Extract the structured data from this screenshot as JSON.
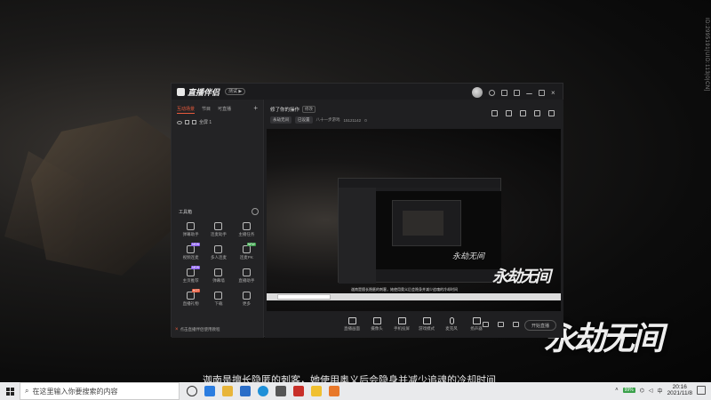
{
  "background": {
    "side_text": "ID:2995191|UID:113|0|CN]",
    "game_logo": "永劫无间",
    "subtitle": "迦南是擅长隐匿的刺客，她使用奥义后会隐身并减少追魂的冷却时间"
  },
  "app": {
    "name": "直播伴侣",
    "version_badge": "测试 ▶",
    "scene_tabs": [
      "互动场景",
      "节目",
      "可直播"
    ],
    "scene_add": "+",
    "scene_item": "全屏 1",
    "toolbox_label": "工具箱",
    "tools": [
      {
        "label": "弹幕助手",
        "icon": "danmaku-icon",
        "tag": ""
      },
      {
        "label": "连麦助手",
        "icon": "mic-assist-icon",
        "tag": ""
      },
      {
        "label": "主播任务",
        "icon": "task-icon",
        "tag": ""
      },
      {
        "label": "视频连麦",
        "icon": "video-link-icon",
        "tag": "NEW"
      },
      {
        "label": "多人连麦",
        "icon": "group-link-icon",
        "tag": ""
      },
      {
        "label": "连麦PK",
        "icon": "pk-icon",
        "tag": "NEW"
      },
      {
        "label": "主页推荐",
        "icon": "home-rec-icon",
        "tag": "NEW"
      },
      {
        "label": "弹幕墙",
        "icon": "barrage-wall-icon",
        "tag": ""
      },
      {
        "label": "直播助手",
        "icon": "live-help-icon",
        "tag": ""
      },
      {
        "label": "直播礼物",
        "icon": "gift-icon",
        "tag": "HOT"
      },
      {
        "label": "下载",
        "icon": "download-icon",
        "tag": ""
      },
      {
        "label": "更多",
        "icon": "more-icon",
        "tag": ""
      }
    ],
    "left_footer": "点击直播伴侣使用教程",
    "main": {
      "title": "修了你的操作",
      "edit": "修改",
      "meta": [
        "永劫无间",
        "已设置",
        "八十一步游戏",
        "15121142",
        "0"
      ]
    },
    "controls": [
      {
        "label": "直播画面",
        "icon": "screen-icon"
      },
      {
        "label": "摄像头",
        "icon": "camera-icon"
      },
      {
        "label": "手机投屏",
        "icon": "phone-cast-icon"
      },
      {
        "label": "游戏模式",
        "icon": "game-icon"
      },
      {
        "label": "麦克风",
        "icon": "mic-icon"
      },
      {
        "label": "扬声器",
        "icon": "speaker-icon"
      }
    ],
    "go_live": "开始直播",
    "preview_logo": "永劫无间",
    "nested_logo": "永劫无间",
    "mini_caption": "迦南是擅长隐匿的刺客，她使用奥义后会隐身并减少追魂的冷却时间"
  },
  "taskbar": {
    "search_placeholder": "在这里输入你要搜索的内容",
    "battery": "99%",
    "time": "20:16",
    "date": "2021/11/8",
    "lang": "中",
    "icons": [
      "task-view-icon",
      "edge-icon",
      "file-explorer-icon",
      "mail-icon",
      "ie-icon",
      "store-icon",
      "app-red-icon",
      "app-yellow-icon",
      "app-orange-icon"
    ]
  },
  "colors": {
    "accent": "#e85a3c",
    "window_bg": "#1e1e20",
    "taskbar_bg": "#e9eaec"
  }
}
